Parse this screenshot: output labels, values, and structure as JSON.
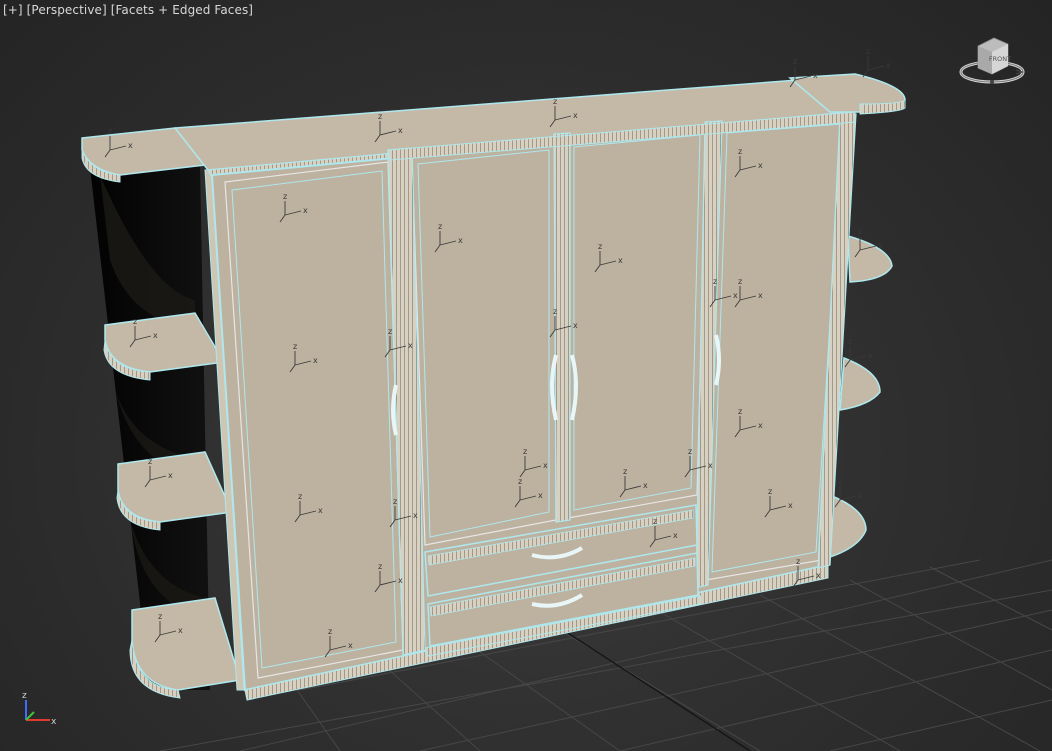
{
  "viewport": {
    "labels": [
      "[+]",
      "[Perspective]",
      "[Facets + Edged Faces]"
    ],
    "viewcube_face": "FRONT",
    "gizmo_axes": {
      "z": "z",
      "x": "x"
    }
  },
  "colors": {
    "background": "#303030",
    "grid": "#454545",
    "panel_fill": "#bdb19f",
    "shelf_fill": "#c4b9a6",
    "selection_edge": "#aee8ee",
    "edge_wire": "#e6e6e6",
    "shadow": "#080808"
  },
  "icons": [
    "viewcube-icon",
    "world-axis-tripod-icon",
    "pivot-gizmo-icon"
  ]
}
